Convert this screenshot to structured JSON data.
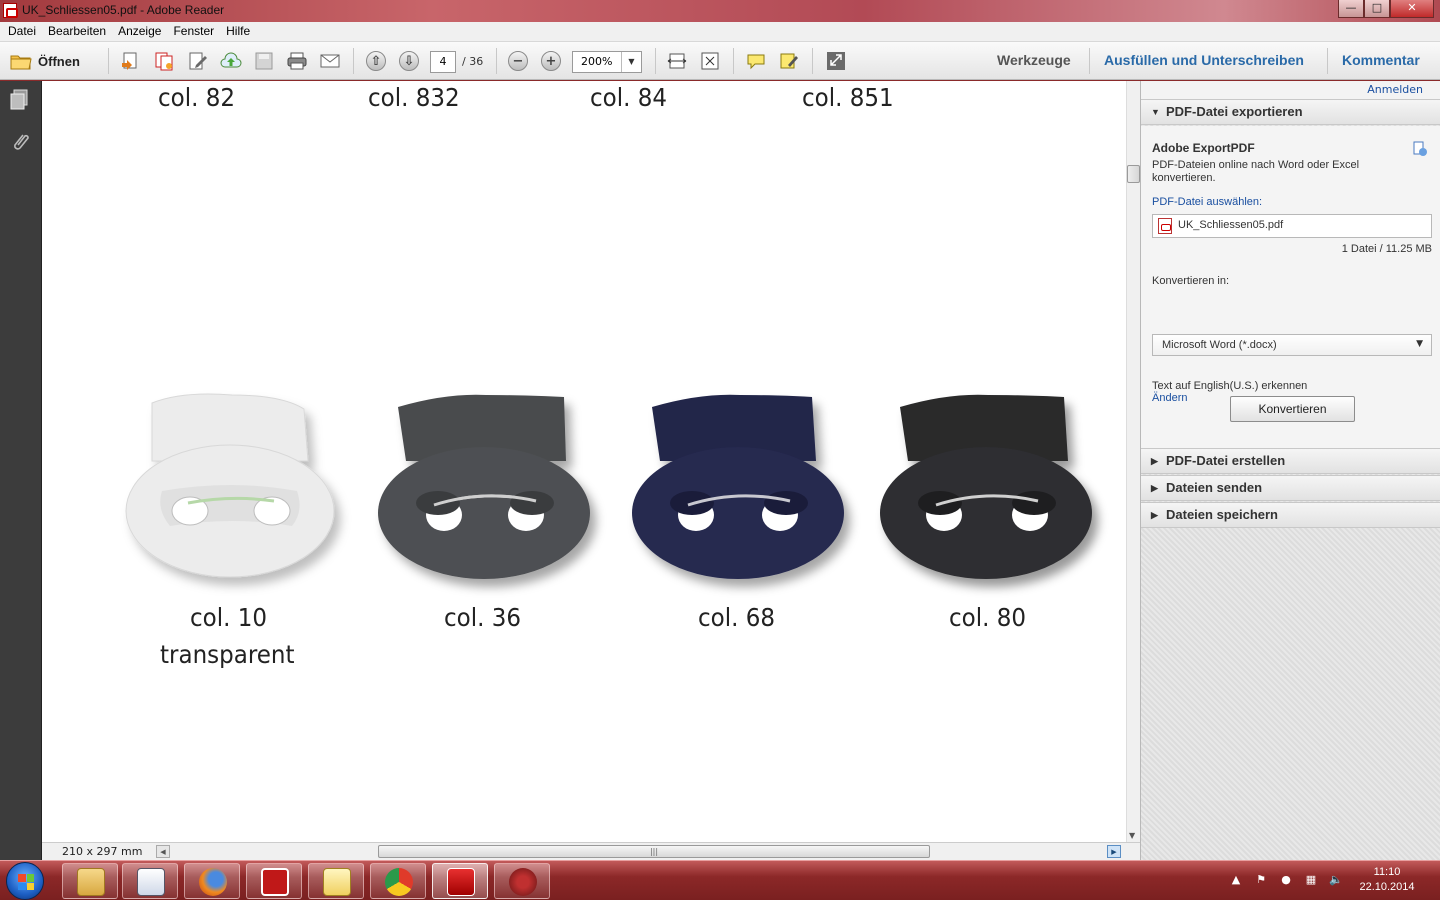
{
  "window": {
    "title": "UK_Schliessen05.pdf - Adobe Reader"
  },
  "menu": [
    "Datei",
    "Bearbeiten",
    "Anzeige",
    "Fenster",
    "Hilfe"
  ],
  "toolbar": {
    "open_label": "Öffnen",
    "page_current": "4",
    "page_total": "/ 36",
    "zoom": "200%",
    "tools_label": "Werkzeuge",
    "fill_sign_label": "Ausfüllen und Unterschreiben",
    "comment_label": "Kommentar"
  },
  "document": {
    "top_labels": [
      "col. 82",
      "col. 832",
      "col. 84",
      "col. 851"
    ],
    "products": [
      {
        "label": "col. 10",
        "sublabel": "transparent",
        "color": "#ececec"
      },
      {
        "label": "col. 36",
        "sublabel": "",
        "color": "#4a4c4e"
      },
      {
        "label": "col. 68",
        "sublabel": "",
        "color": "#22254a"
      },
      {
        "label": "col. 80",
        "sublabel": "",
        "color": "#2a2a2c"
      }
    ],
    "page_size": "210 x 297 mm"
  },
  "rightpane": {
    "login": "Anmelden",
    "export": {
      "header": "PDF-Datei exportieren",
      "title": "Adobe ExportPDF",
      "description": "PDF-Dateien online nach Word oder Excel konvertieren.",
      "choose_label": "PDF-Datei auswählen:",
      "file_name": "UK_Schliessen05.pdf",
      "file_info": "1 Datei / 11.25 MB",
      "convert_to_label": "Konvertieren in:",
      "convert_to_value": "Microsoft Word (*.docx)",
      "ocr_text": "Text auf English(U.S.) erkennen",
      "change_link": "Ändern",
      "convert_button": "Konvertieren"
    },
    "sections": [
      "PDF-Datei erstellen",
      "Dateien senden",
      "Dateien speichern"
    ]
  },
  "taskbar": {
    "time": "11:10",
    "date": "22.10.2014"
  }
}
